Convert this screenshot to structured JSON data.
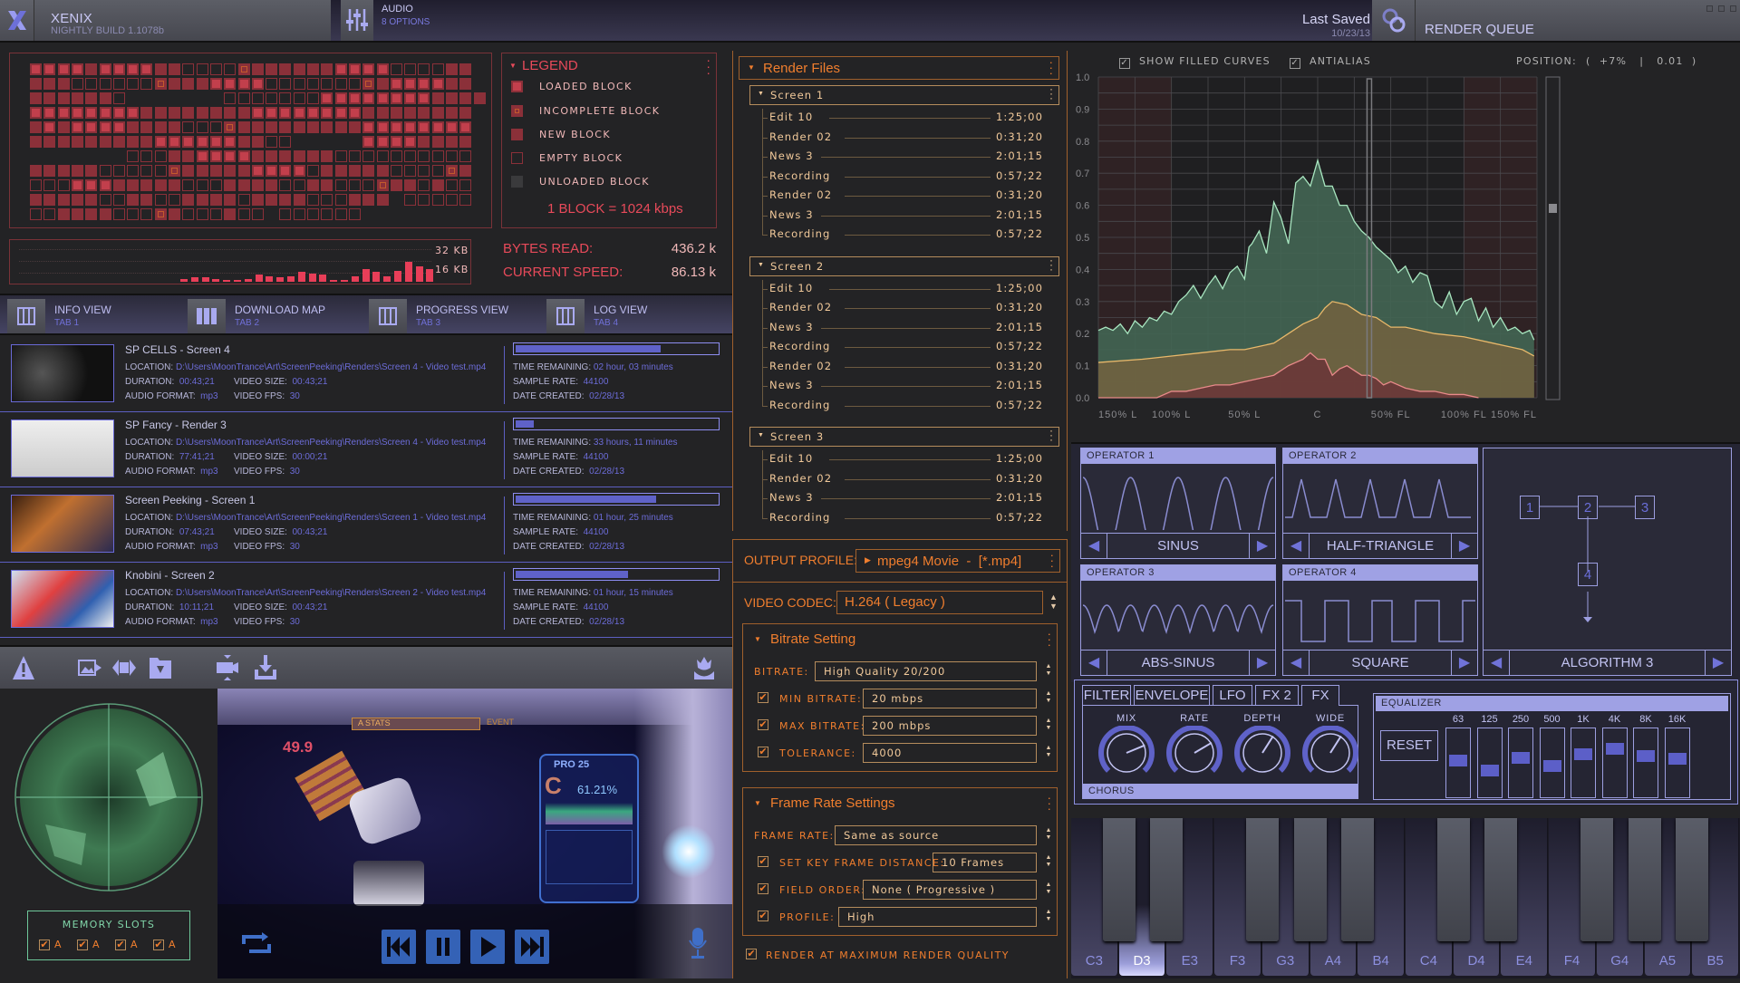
{
  "header": {
    "app_name": "XENIX",
    "build": "NIGHTLY BUILD 1.1078b",
    "audio_label": "AUDIO",
    "audio_sub": "8 OPTIONS",
    "last_saved_label": "Last Saved",
    "last_saved_date": "10/23/13",
    "render_queue_label": "RENDER QUEUE"
  },
  "legend": {
    "title": "LEGEND",
    "items": [
      {
        "label": "LOADED BLOCK",
        "type": "loaded"
      },
      {
        "label": "INCOMPLETE BLOCK",
        "type": "incomplete"
      },
      {
        "label": "NEW BLOCK",
        "type": "new"
      },
      {
        "label": "EMPTY BLOCK",
        "type": "empty"
      },
      {
        "label": "UNLOADED BLOCK",
        "type": "unloaded"
      }
    ],
    "block_note": "1 BLOCK = 1024 kbps"
  },
  "block_map": {
    "rows": [
      "LLLLNLLLLNNEEEEINNNNNNLLLLEEEENN",
      "NNNEEEEEEINNNLLLLEEEEEEEINLLLLNN",
      "NNNNNNE_______EEEEEEELLLLLLLLNNNN",
      "LLLLLLLLNNNNNNNNLLLLLLLLNNNNNNNN",
      "NLNLLLLNNNNEEEINNNNNNNNNLLLLLLLL",
      "NNNNNNNNNLLLLLLNNEE_____LLLLNNNN",
      "_______EEENNLLLLNNNNNNEEEEEEEEEE",
      "NNNNNEEEEEINNNNNLLLLENNNNNEEEEIN",
      "EEELLLNNNNNEEENNNNEENNEEEINNENEE",
      "NNNNNEENNEENNNNENNNNEEENNN_EEEEE",
      "EENNNNEEEINEEENEE EEEEEE"
    ]
  },
  "bandwidth": {
    "label_top": "32 KB",
    "label_bottom": "16 KB",
    "bars": [
      2,
      3,
      3,
      2,
      1,
      1,
      2,
      5,
      4,
      3,
      4,
      7,
      6,
      5,
      1,
      1,
      4,
      9,
      7,
      4,
      8,
      14,
      11,
      9
    ]
  },
  "stats": {
    "bytes_read_label": "BYTES READ:",
    "bytes_read_value": "436.2 k",
    "speed_label": "CURRENT SPEED:",
    "speed_value": "86.13 k"
  },
  "tabs": [
    {
      "label": "INFO VIEW",
      "sub": "TAB 1"
    },
    {
      "label": "DOWNLOAD MAP",
      "sub": "TAB 2"
    },
    {
      "label": "PROGRESS VIEW",
      "sub": "TAB 3"
    },
    {
      "label": "LOG VIEW",
      "sub": "TAB 4"
    }
  ],
  "renders": [
    {
      "title": "SP CELLS - Screen 4",
      "location": "D:\\Users\\MoonTrance\\Art\\ScreenPeeking\\Renders\\Screen 4 - Video test.mp4",
      "duration": "00:43;21",
      "video_size": "00:43;21",
      "audio_format": "mp3",
      "video_fps": "30",
      "time_remaining": "02 hour, 03 minutes",
      "sample_rate": "44100",
      "date_created": "02/28/13",
      "progress": 0.72
    },
    {
      "title": "SP Fancy - Render 3",
      "location": "D:\\Users\\MoonTrance\\Art\\ScreenPeeking\\Renders\\Screen 4 - Video test.mp4",
      "duration": "77:41;21",
      "video_size": "00:00;21",
      "audio_format": "mp3",
      "video_fps": "30",
      "time_remaining": "33 hours, 11 minutes",
      "sample_rate": "44100",
      "date_created": "02/28/13",
      "progress": 0.09
    },
    {
      "title": "Screen Peeking - Screen 1",
      "location": "D:\\Users\\MoonTrance\\Art\\ScreenPeeking\\Renders\\Screen 1 - Video test.mp4",
      "duration": "07:43;21",
      "video_size": "00:43;21",
      "audio_format": "mp3",
      "video_fps": "30",
      "time_remaining": "01 hour, 25 minutes",
      "sample_rate": "44100",
      "date_created": "02/28/13",
      "progress": 0.7
    },
    {
      "title": "Knobini - Screen 2",
      "location": "D:\\Users\\MoonTrance\\Art\\ScreenPeeking\\Renders\\Screen 2 - Video test.mp4",
      "duration": "10:11;21",
      "video_size": "00:43;21",
      "audio_format": "mp3",
      "video_fps": "30",
      "time_remaining": "01 hour, 15 minutes",
      "sample_rate": "44100",
      "date_created": "02/28/13",
      "progress": 0.56
    }
  ],
  "render_labels": {
    "location": "LOCATION:",
    "duration": "DURATION:",
    "video_size": "VIDEO SIZE:",
    "audio_format": "AUDIO FORMAT:",
    "video_fps": "VIDEO FPS:",
    "time_remaining": "TIME REMAINING:",
    "sample_rate": "SAMPLE RATE:",
    "date_created": "DATE CREATED:"
  },
  "toolbar_icons": [
    "warning-icon",
    "export-image-icon",
    "convert-video-icon",
    "folder-import-icon",
    "video-fit-icon",
    "download-icon",
    "lotus-icon"
  ],
  "memory": {
    "title": "MEMORY SLOTS",
    "slots": [
      "A",
      "A",
      "A",
      "A"
    ]
  },
  "player": {
    "hud_score": "49.9",
    "hud_banner": "A STATS",
    "hud_event": "EVENT",
    "result_title": "PRO 25",
    "result_grade": "C",
    "result_percent": "61.21%",
    "buttons": [
      "repeat",
      "rewind",
      "pause",
      "play",
      "fast-forward",
      "microphone"
    ]
  },
  "render_files": {
    "title": "Render Files",
    "groups": [
      {
        "name": "Screen 1",
        "items": [
          {
            "name": "Edit 10",
            "time": "1:25;00"
          },
          {
            "name": "Render 02",
            "time": "0:31;20"
          },
          {
            "name": "News 3",
            "time": "2:01;15"
          },
          {
            "name": "Recording",
            "time": "0:57;22"
          },
          {
            "name": "Render 02",
            "time": "0:31;20"
          },
          {
            "name": "News 3",
            "time": "2:01;15"
          },
          {
            "name": "Recording",
            "time": "0:57;22"
          }
        ]
      },
      {
        "name": "Screen 2",
        "items": [
          {
            "name": "Edit 10",
            "time": "1:25;00"
          },
          {
            "name": "Render 02",
            "time": "0:31;20"
          },
          {
            "name": "News 3",
            "time": "2:01;15"
          },
          {
            "name": "Recording",
            "time": "0:57;22"
          },
          {
            "name": "Render 02",
            "time": "0:31;20"
          },
          {
            "name": "News 3",
            "time": "2:01;15"
          },
          {
            "name": "Recording",
            "time": "0:57;22"
          }
        ]
      },
      {
        "name": "Screen 3",
        "items": [
          {
            "name": "Edit 10",
            "time": "1:25;00"
          },
          {
            "name": "Render 02",
            "time": "0:31;20"
          },
          {
            "name": "News 3",
            "time": "2:01;15"
          },
          {
            "name": "Recording",
            "time": "0:57;22"
          }
        ]
      }
    ]
  },
  "output": {
    "profile_label": "OUTPUT PROFILE:",
    "profile_value": "mpeg4 Movie  -  [*.mp4]",
    "codec_label": "VIDEO CODEC:",
    "codec_value": "H.264 ( Legacy )",
    "bitrate": {
      "title": "Bitrate Setting",
      "bitrate_label": "BITRATE:",
      "bitrate_value": "High Quality 20/200",
      "min_label": "MIN BITRATE:",
      "min_value": "20 mbps",
      "min_checked": true,
      "max_label": "MAX BITRATE:",
      "max_value": "200 mbps",
      "max_checked": true,
      "tol_label": "TOLERANCE:",
      "tol_value": "4000",
      "tol_checked": true
    },
    "framerate": {
      "title": "Frame Rate Settings",
      "rate_label": "FRAME RATE:",
      "rate_value": "Same as source",
      "key_label": "SET KEY FRAME DISTANCE:",
      "key_value": "10 Frames",
      "field_label": "FIELD ORDER:",
      "field_value": "None ( Progressive )",
      "profile_label": "PROFILE:",
      "profile_value": "High"
    },
    "max_quality_label": "RENDER AT MAXIMUM RENDER QUALITY",
    "max_quality_checked": true
  },
  "curve_options": {
    "filled_label": "SHOW FILLED CURVES",
    "filled_checked": true,
    "antialias_label": "ANTIALIAS",
    "antialias_checked": true,
    "position_label": "POSITION:",
    "position_value": "(  +7%   |   0.01  )"
  },
  "chart_data": {
    "type": "area",
    "title": "",
    "xlabel": "",
    "ylabel": "",
    "x_ticks": [
      "150% L",
      "100% L",
      "50% L",
      "C",
      "50% FL",
      "100% FL",
      "150% FL"
    ],
    "y_ticks": [
      "0.0",
      "0.1",
      "0.2",
      "0.3",
      "0.4",
      "0.5",
      "0.6",
      "0.7",
      "0.8",
      "0.9",
      "1.0"
    ],
    "xlim": [
      -150,
      150
    ],
    "ylim": [
      0,
      1
    ],
    "grid": true,
    "cursor_x": 35,
    "series": [
      {
        "name": "green",
        "color": "#a8e6c0",
        "fill": "#426452",
        "x": [
          -150,
          -145,
          -140,
          -135,
          -130,
          -125,
          -120,
          -115,
          -110,
          -105,
          -100,
          -95,
          -90,
          -85,
          -80,
          -75,
          -70,
          -65,
          -60,
          -55,
          -50,
          -47,
          -45,
          -40,
          -35,
          -30,
          -25,
          -20,
          -15,
          -10,
          -5,
          0,
          5,
          10,
          15,
          20,
          25,
          30,
          35,
          40,
          45,
          50,
          55,
          60,
          65,
          70,
          75,
          80,
          85,
          90,
          95,
          100,
          105,
          110,
          115,
          120,
          125,
          130,
          135,
          140,
          145,
          148
        ],
        "y": [
          0.21,
          0.22,
          0.21,
          0.23,
          0.2,
          0.24,
          0.22,
          0.25,
          0.24,
          0.27,
          0.26,
          0.3,
          0.32,
          0.35,
          0.31,
          0.35,
          0.38,
          0.34,
          0.39,
          0.41,
          0.37,
          0.47,
          0.48,
          0.52,
          0.45,
          0.61,
          0.56,
          0.48,
          0.67,
          0.69,
          0.66,
          0.74,
          0.66,
          0.66,
          0.6,
          0.6,
          0.55,
          0.52,
          0.5,
          0.47,
          0.45,
          0.43,
          0.39,
          0.41,
          0.36,
          0.39,
          0.38,
          0.3,
          0.28,
          0.33,
          0.26,
          0.3,
          0.31,
          0.24,
          0.28,
          0.22,
          0.25,
          0.21,
          0.22,
          0.2,
          0.21,
          0.18
        ]
      },
      {
        "name": "yellow",
        "color": "#e8b86a",
        "fill": "#6f6240",
        "x": [
          -150,
          -120,
          -100,
          -80,
          -60,
          -50,
          -40,
          -30,
          -20,
          -10,
          0,
          5,
          10,
          20,
          30,
          40,
          50,
          60,
          80,
          100,
          120,
          140,
          148
        ],
        "y": [
          0.11,
          0.12,
          0.13,
          0.14,
          0.15,
          0.15,
          0.16,
          0.17,
          0.2,
          0.23,
          0.25,
          0.28,
          0.3,
          0.29,
          0.26,
          0.25,
          0.22,
          0.22,
          0.2,
          0.19,
          0.17,
          0.15,
          0.13
        ]
      },
      {
        "name": "red",
        "color": "#e88a8a",
        "fill": "#6a3838",
        "x": [
          -150,
          -110,
          -100,
          -90,
          -80,
          -70,
          -60,
          -50,
          -40,
          -30,
          -20,
          -15,
          -10,
          -5,
          0,
          5,
          10,
          15,
          20,
          30,
          35,
          40,
          45,
          50,
          60,
          70,
          80,
          90,
          100,
          110
        ],
        "y": [
          0,
          0,
          0.02,
          0.02,
          0.03,
          0.04,
          0.04,
          0.05,
          0.06,
          0.07,
          0.1,
          0.11,
          0.12,
          0.14,
          0.12,
          0.12,
          0.07,
          0.09,
          0.1,
          0.07,
          0.07,
          0.06,
          0.04,
          0.05,
          0.03,
          0.02,
          0.02,
          0.01,
          0.01,
          0
        ]
      }
    ]
  },
  "operators": [
    {
      "title": "OPERATOR 1",
      "wave": "SINUS"
    },
    {
      "title": "OPERATOR 2",
      "wave": "HALF-TRIANGLE"
    },
    {
      "title": "OPERATOR 3",
      "wave": "ABS-SINUS"
    },
    {
      "title": "OPERATOR 4",
      "wave": "SQUARE"
    }
  ],
  "algorithm": {
    "name": "ALGORITHM 3",
    "nodes": [
      "1",
      "2",
      "3",
      "4"
    ]
  },
  "fx": {
    "tabs": [
      "FILTER",
      "ENVELOPE",
      "LFO",
      "FX 2",
      "FX"
    ],
    "active_tab": "FX",
    "knobs": [
      {
        "label": "MIX",
        "value": 0.75
      },
      {
        "label": "RATE",
        "value": 0.72
      },
      {
        "label": "DEPTH",
        "value": 0.62
      },
      {
        "label": "WIDE",
        "value": 0.62
      }
    ],
    "effect_name": "CHORUS"
  },
  "equalizer": {
    "title": "EQUALIZER",
    "reset_label": "RESET",
    "bands": [
      {
        "label": "63",
        "value": 0.55
      },
      {
        "label": "125",
        "value": 0.38
      },
      {
        "label": "250",
        "value": 0.6
      },
      {
        "label": "500",
        "value": 0.45
      },
      {
        "label": "1K",
        "value": 0.65
      },
      {
        "label": "4K",
        "value": 0.75
      },
      {
        "label": "8K",
        "value": 0.63
      },
      {
        "label": "16K",
        "value": 0.58
      }
    ]
  },
  "piano": {
    "keys": [
      "C3",
      "D3",
      "E3",
      "F3",
      "G3",
      "A4",
      "B4",
      "C4",
      "D4",
      "E4",
      "F4",
      "G4",
      "A5",
      "B5"
    ],
    "active": "D3"
  }
}
